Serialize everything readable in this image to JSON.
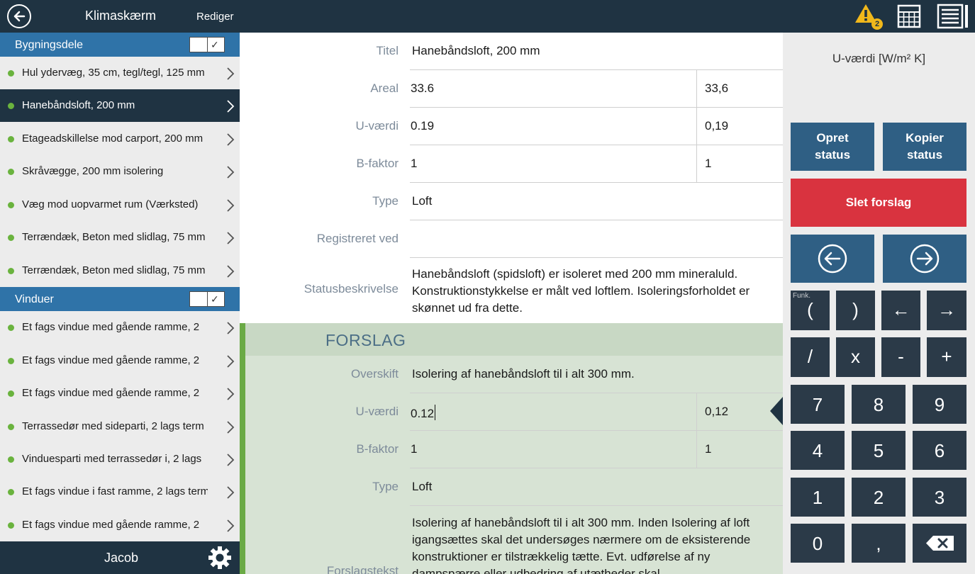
{
  "topbar": {
    "title": "Klimaskærm",
    "edit_label": "Rediger",
    "warning_count": "2",
    "icons": {
      "back": "back-arrow-icon",
      "warning": "warning-icon",
      "calculator": "calculator-icon",
      "list": "list-icon"
    },
    "colors": {
      "bar": "#1f3342",
      "warning": "#f1b81b"
    }
  },
  "sidebar": {
    "groups": [
      {
        "label": "Bygningsdele",
        "checked": true,
        "items": [
          {
            "label": "Hul ydervæg, 35 cm, tegl/tegl, 125 mm"
          },
          {
            "label": "Hanebåndsloft, 200 mm",
            "selected": true
          },
          {
            "label": "Etageadskillelse mod carport, 200 mm"
          },
          {
            "label": "Skråvægge, 200 mm isolering"
          },
          {
            "label": "Væg mod uopvarmet rum (Værksted)"
          },
          {
            "label": "Terrændæk, Beton med slidlag, 75 mm"
          },
          {
            "label": "Terrændæk, Beton med slidlag, 75 mm"
          }
        ]
      },
      {
        "label": "Vinduer",
        "checked": true,
        "items": [
          {
            "label": "Et fags vindue med gående ramme, 2"
          },
          {
            "label": "Et fags vindue med gående ramme, 2"
          },
          {
            "label": "Et fags vindue med gående ramme, 2"
          },
          {
            "label": "Terrassedør med sideparti, 2 lags term"
          },
          {
            "label": "Vinduesparti med terrassedør i, 2 lags"
          },
          {
            "label": "Et fags vindue i fast ramme, 2 lags term"
          },
          {
            "label": "Et fags vindue med gående ramme, 2"
          }
        ]
      }
    ],
    "user_name": "Jacob",
    "colors": {
      "group_header": "#2f73a8",
      "status_dot": "#6ab33e"
    }
  },
  "form": {
    "titel": {
      "label": "Titel",
      "value": "Hanebåndsloft, 200 mm"
    },
    "areal": {
      "label": "Areal",
      "value": "33.6",
      "calc": "33,6"
    },
    "uvaerdi": {
      "label": "U-værdi",
      "value": "0.19",
      "calc": "0,19"
    },
    "bfaktor": {
      "label": "B-faktor",
      "value": "1",
      "calc": "1"
    },
    "type": {
      "label": "Type",
      "value": "Loft"
    },
    "registreret": {
      "label": "Registreret ved",
      "value": ""
    },
    "status": {
      "label": "Statusbeskrivelse",
      "value": "Hanebåndsloft (spidsloft) er isoleret med 200 mm mineraluld. Konstruktionstykkelse er målt ved loftlem. Isoleringsforholdet er skønnet ud fra dette."
    }
  },
  "forslag": {
    "heading": "FORSLAG",
    "overskrift": {
      "label": "Overskift",
      "value": "Isolering af hanebåndsloft til i alt 300 mm."
    },
    "uvaerdi": {
      "label": "U-værdi",
      "value": "0.12",
      "calc": "0,12"
    },
    "bfaktor": {
      "label": "B-faktor",
      "value": "1",
      "calc": "1"
    },
    "type": {
      "label": "Type",
      "value": "Loft"
    },
    "tekst": {
      "label": "Forslagstekst",
      "value": "Isolering af hanebåndsloft til i alt 300 mm. Inden Isolering af loft igangsættes skal det undersøges nærmere om de eksisterende konstruktioner er tilstrækkelig tætte. Evt. udførelse af ny dampspærre eller udbedring af utætheder skal"
    },
    "colors": {
      "area": "#d7e3d4",
      "stripe": "#6aaa45"
    }
  },
  "panel": {
    "title": "U-værdi [W/m² K]",
    "create_status": [
      "Opret",
      "status"
    ],
    "copy_status": [
      "Kopier",
      "status"
    ],
    "delete_label": "Slet forslag",
    "funk_label": "Funk.",
    "keys_row1": [
      "(",
      ")",
      "←",
      "→"
    ],
    "keys_row2": [
      "/",
      "x",
      "-",
      "+"
    ],
    "keys_digits": [
      "7",
      "8",
      "9",
      "4",
      "5",
      "6",
      "1",
      "2",
      "3",
      "0",
      ","
    ],
    "colors": {
      "button": "#2f5f84",
      "delete": "#d9333f",
      "key": "#2b3a48"
    }
  }
}
